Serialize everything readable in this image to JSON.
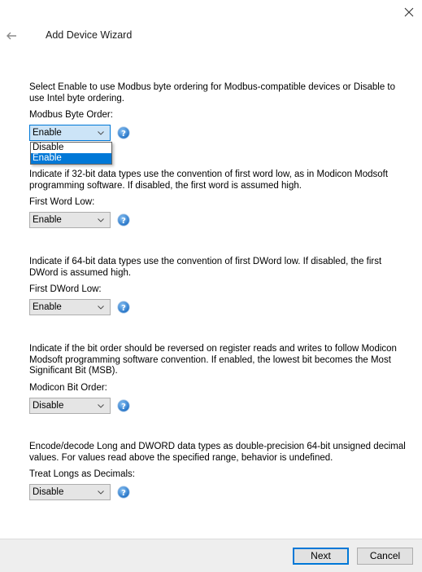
{
  "window": {
    "title": "Add Device Wizard",
    "close_icon": "close-icon",
    "back_icon": "back-arrow-icon"
  },
  "sections": [
    {
      "description": "Select Enable to use Modbus byte ordering for Modbus-compatible devices or Disable to use Intel byte ordering.",
      "label": "Modbus Byte Order:",
      "value": "Enable",
      "open": true,
      "options": [
        {
          "label": "Disable",
          "selected": false
        },
        {
          "label": "Enable",
          "selected": true
        }
      ]
    },
    {
      "description": "Indicate if 32-bit data types use the convention of first word low, as in Modicon Modsoft programming software. If disabled, the first word is assumed high.",
      "label": "First Word Low:",
      "value": "Enable"
    },
    {
      "description": "Indicate if 64-bit data types use the convention of first DWord low. If disabled, the first DWord is assumed high.",
      "label": "First DWord Low:",
      "value": "Enable"
    },
    {
      "description": "Indicate if the bit order should be reversed on register reads and writes to follow Modicon Modsoft programming software convention. If enabled, the lowest bit becomes the Most Significant Bit (MSB).",
      "label": "Modicon Bit Order:",
      "value": "Disable"
    },
    {
      "description": "Encode/decode Long and DWORD data types as double-precision 64-bit unsigned decimal values. For values read above the specified range, behavior is undefined.",
      "label": "Treat Longs as Decimals:",
      "value": "Disable"
    }
  ],
  "footer": {
    "next_label": "Next",
    "cancel_label": "Cancel"
  },
  "colors": {
    "accent": "#0078d7",
    "help_icon": "#2f7fd1",
    "footer_bg": "#eeeeee"
  }
}
